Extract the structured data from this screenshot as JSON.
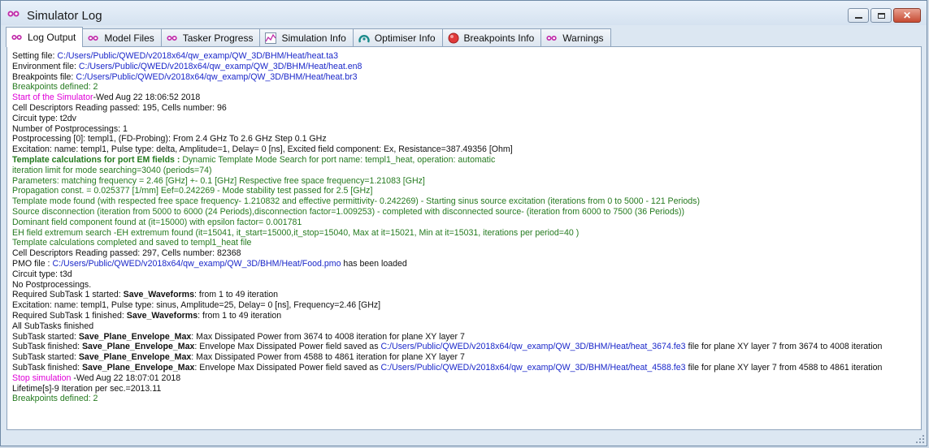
{
  "window": {
    "title": "Simulator Log"
  },
  "tabs": [
    {
      "label": "Log Output",
      "icon": "qw-logo-icon"
    },
    {
      "label": "Model Files",
      "icon": "qw-logo-icon"
    },
    {
      "label": "Tasker Progress",
      "icon": "qw-logo-icon"
    },
    {
      "label": "Simulation Info",
      "icon": "chart-icon"
    },
    {
      "label": "Optimiser Info",
      "icon": "optimiser-icon"
    },
    {
      "label": "Breakpoints Info",
      "icon": "stop-icon"
    },
    {
      "label": "Warnings",
      "icon": "qw-logo-icon"
    }
  ],
  "colors": {
    "blue": "#1a27c9",
    "green": "#257a1f",
    "magenta": "#e000d8"
  },
  "log": [
    [
      {
        "t": "Setting file: ",
        "c": ""
      },
      {
        "t": "C:/Users/Public/QWED/v2018x64/qw_examp/QW_3D/BHM/Heat/heat.ta3",
        "c": "blue"
      }
    ],
    [
      {
        "t": "Environment file: ",
        "c": ""
      },
      {
        "t": "C:/Users/Public/QWED/v2018x64/qw_examp/QW_3D/BHM/Heat/heat.en8",
        "c": "blue"
      }
    ],
    [
      {
        "t": "Breakpoints file: ",
        "c": ""
      },
      {
        "t": "C:/Users/Public/QWED/v2018x64/qw_examp/QW_3D/BHM/Heat/heat.br3",
        "c": "blue"
      }
    ],
    [
      {
        "t": "Breakpoints defined: 2",
        "c": "green"
      }
    ],
    [
      {
        "t": "Start of the Simulator",
        "c": "mag"
      },
      {
        "t": "-Wed Aug 22 18:06:52 2018",
        "c": ""
      }
    ],
    [
      {
        "t": "Cell Descriptors Reading passed: 195, Cells number: 96",
        "c": ""
      }
    ],
    [
      {
        "t": "Circuit type: t2dv",
        "c": ""
      }
    ],
    [
      {
        "t": "Number of Postprocessings: 1",
        "c": ""
      }
    ],
    [
      {
        "t": "Postprocessing [0]: templ1, (FD-Probing): From 2.4 GHz To 2.6 GHz Step 0.1 GHz",
        "c": ""
      }
    ],
    [
      {
        "t": "Excitation: name: templ1, Pulse type: delta, Amplitude=1, Delay= 0 [ns], Excited field component: Ex, Resistance=387.49356 [Ohm]",
        "c": ""
      }
    ],
    [
      {
        "t": "Template calculations for port EM fields : ",
        "c": "green",
        "b": true
      },
      {
        "t": "Dynamic Template Mode Search for port name: templ1_heat, operation: automatic",
        "c": "green"
      }
    ],
    [
      {
        "t": "iteration limit for mode searching=3040 (periods=74)",
        "c": "green"
      }
    ],
    [
      {
        "t": "Parameters: matching frequency = 2.46 [GHz] +- 0.1 [GHz] Respective free space frequency=1.21083 [GHz]",
        "c": "green"
      }
    ],
    [
      {
        "t": "Propagation const. = 0.025377 [1/mm] Eef=0.242269 - Mode stability test passed for 2.5 [GHz]",
        "c": "green"
      }
    ],
    [
      {
        "t": "Template mode found (with respected free space frequency- 1.210832 and effective permittivity- 0.242269) - Starting sinus source excitation (iterations from 0 to 5000 - 121 Periods)",
        "c": "green"
      }
    ],
    [
      {
        "t": "Source disconnection (iteration from 5000 to 6000 (24 Periods),disconnection factor=1.009253) - completed with disconnected source- (iteration from 6000 to 7500 (36 Periods))",
        "c": "green"
      }
    ],
    [
      {
        "t": "Dominant field component found at (it=15000) with epsilon factor= 0.001781",
        "c": "green"
      }
    ],
    [
      {
        "t": "EH field extremum search -EH extremum found (it=15041, it_start=15000,it_stop=15040, Max at it=15021, Min at it=15031, iterations per period=40 )",
        "c": "green"
      }
    ],
    [
      {
        "t": "Template calculations completed and saved to templ1_heat file",
        "c": "green"
      }
    ],
    [
      {
        "t": "Cell Descriptors Reading passed: 297, Cells number: 82368",
        "c": ""
      }
    ],
    [
      {
        "t": "PMO file : ",
        "c": ""
      },
      {
        "t": "C:/Users/Public/QWED/v2018x64/qw_examp/QW_3D/BHM/Heat/Food.pmo",
        "c": "blue"
      },
      {
        "t": " has been loaded",
        "c": ""
      }
    ],
    [
      {
        "t": "Circuit type: t3d",
        "c": ""
      }
    ],
    [
      {
        "t": "No Postprocessings.",
        "c": ""
      }
    ],
    [
      {
        "t": "Required SubTask 1 started: ",
        "c": ""
      },
      {
        "t": "Save_Waveforms",
        "c": "",
        "b": true
      },
      {
        "t": ": from 1 to 49 iteration",
        "c": ""
      }
    ],
    [
      {
        "t": "Excitation: name: templ1, Pulse type: sinus, Amplitude=25, Delay= 0 [ns], Frequency=2.46 [GHz]",
        "c": ""
      }
    ],
    [
      {
        "t": "Required SubTask 1 finished: ",
        "c": ""
      },
      {
        "t": "Save_Waveforms",
        "c": "",
        "b": true
      },
      {
        "t": ": from 1 to 49 iteration",
        "c": ""
      }
    ],
    [
      {
        "t": "All SubTasks finished",
        "c": ""
      }
    ],
    [
      {
        "t": "SubTask started: ",
        "c": ""
      },
      {
        "t": "Save_Plane_Envelope_Max",
        "c": "",
        "b": true
      },
      {
        "t": ": Max Dissipated Power from 3674 to 4008 iteration for plane XY layer 7",
        "c": ""
      }
    ],
    [
      {
        "t": "SubTask finished: ",
        "c": ""
      },
      {
        "t": "Save_Plane_Envelope_Max",
        "c": "",
        "b": true
      },
      {
        "t": ": Envelope Max Dissipated Power field saved as ",
        "c": ""
      },
      {
        "t": "C:/Users/Public/QWED/v2018x64/qw_examp/QW_3D/BHM/Heat/heat_3674.fe3",
        "c": "blue"
      },
      {
        "t": " file for plane XY layer 7 from 3674 to 4008 iteration",
        "c": ""
      }
    ],
    [
      {
        "t": "SubTask started: ",
        "c": ""
      },
      {
        "t": "Save_Plane_Envelope_Max",
        "c": "",
        "b": true
      },
      {
        "t": ": Max Dissipated Power from 4588 to 4861 iteration for plane XY layer 7",
        "c": ""
      }
    ],
    [
      {
        "t": "SubTask finished: ",
        "c": ""
      },
      {
        "t": "Save_Plane_Envelope_Max",
        "c": "",
        "b": true
      },
      {
        "t": ": Envelope Max Dissipated Power field saved as ",
        "c": ""
      },
      {
        "t": "C:/Users/Public/QWED/v2018x64/qw_examp/QW_3D/BHM/Heat/heat_4588.fe3",
        "c": "blue"
      },
      {
        "t": " file for plane XY layer 7 from 4588 to 4861 iteration",
        "c": ""
      }
    ],
    [
      {
        "t": "Stop simulation ",
        "c": "mag"
      },
      {
        "t": "-Wed Aug 22 18:07:01 2018",
        "c": ""
      }
    ],
    [
      {
        "t": "Lifetime[s]-9 Iteration per sec.=2013.11",
        "c": ""
      }
    ],
    [
      {
        "t": "Breakpoints defined: 2",
        "c": "green"
      }
    ]
  ]
}
